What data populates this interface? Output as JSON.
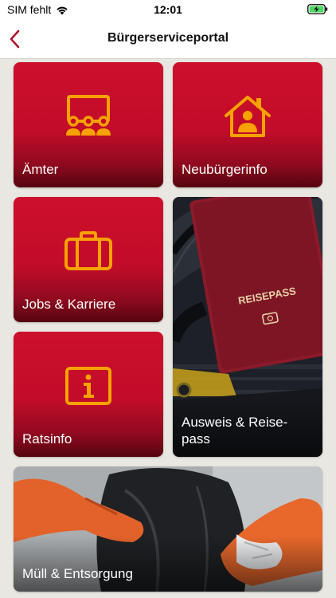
{
  "status": {
    "carrier": "SIM fehlt",
    "time": "12:01"
  },
  "nav": {
    "title": "Bürgerserviceportal"
  },
  "tiles": [
    {
      "label": "Ämter",
      "icon": "group-presentation-icon"
    },
    {
      "label": "Neubürgerinfo",
      "icon": "house-person-icon"
    },
    {
      "label": "Jobs & Karriere",
      "icon": "briefcase-icon"
    },
    {
      "label": "Ausweis & Reise-\npass",
      "icon": "passport-photo"
    },
    {
      "label": "Ratsinfo",
      "icon": "info-icon"
    },
    {
      "label": "Müll & Entsorgung",
      "icon": "garbage-bag-photo"
    }
  ],
  "passport": {
    "cover_text": "REISEPASS"
  },
  "colors": {
    "tile_red": "#c40c2a",
    "icon_orange": "#f7a200",
    "back_arrow": "#b0142b"
  }
}
